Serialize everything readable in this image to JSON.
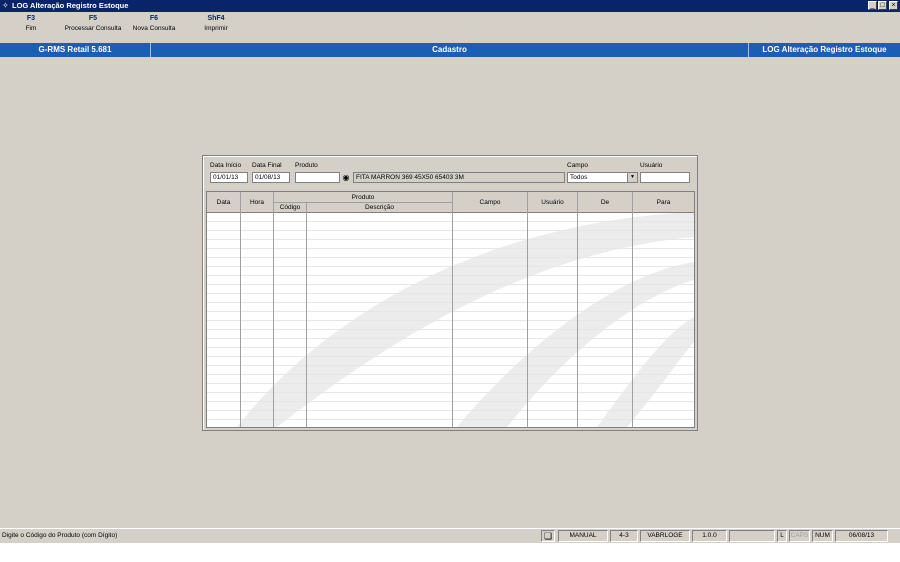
{
  "window": {
    "title": "LOG Alteração Registro Estoque"
  },
  "fkeys": [
    {
      "key": "F3",
      "label": "Fim"
    },
    {
      "key": "F5",
      "label": "Processar Consulta"
    },
    {
      "key": "F6",
      "label": "Nova Consulta"
    },
    {
      "key": "ShF4",
      "label": "Imprimir"
    }
  ],
  "banner": {
    "left": "G-RMS Retail 5.681",
    "center": "Cadastro",
    "right": "LOG Alteração Registro Estoque"
  },
  "filters": {
    "data_inicio_label": "Data Início",
    "data_inicio": "01/01/13",
    "data_final_label": "Data Final",
    "data_final": "01/08/13",
    "produto_label": "Produto",
    "produto_code": "",
    "produto_desc": "FITA MARRON 369 45X50 65403 3M",
    "campo_label": "Campo",
    "campo_value": "Todos",
    "usuario_label": "Usuário",
    "usuario_value": ""
  },
  "table": {
    "headers": {
      "data": "Data",
      "hora": "Hora",
      "produto": "Produto",
      "codigo": "Código",
      "descricao": "Descrição",
      "campo": "Campo",
      "usuario": "Usuário",
      "de": "De",
      "para": "Para"
    },
    "rows": []
  },
  "statusbar": {
    "message": "Digite o Código do Produto (com Dígito)",
    "mode": "MANUAL",
    "code": "4-3",
    "user": "VABRLOGE",
    "version": "1.0.0",
    "l": "L",
    "caps": "CAPS",
    "num": "NUM",
    "date": "06/08/13"
  }
}
